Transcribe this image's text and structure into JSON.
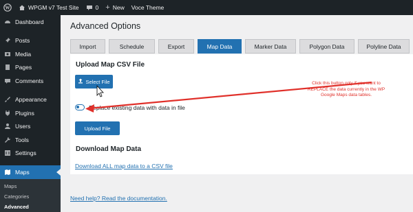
{
  "adminbar": {
    "site_name": "WPGM v7 Test Site",
    "comments_count": "0",
    "new_label": "New",
    "theme_label": "Voce Theme"
  },
  "sidebar": {
    "items": [
      {
        "label": "Dashboard",
        "icon": "dashboard-icon"
      },
      {
        "label": "Posts",
        "icon": "pin-icon"
      },
      {
        "label": "Media",
        "icon": "media-icon"
      },
      {
        "label": "Pages",
        "icon": "page-icon"
      },
      {
        "label": "Comments",
        "icon": "comment-icon"
      },
      {
        "label": "Appearance",
        "icon": "brush-icon"
      },
      {
        "label": "Plugins",
        "icon": "plug-icon"
      },
      {
        "label": "Users",
        "icon": "user-icon"
      },
      {
        "label": "Tools",
        "icon": "wrench-icon"
      },
      {
        "label": "Settings",
        "icon": "settings-icon"
      },
      {
        "label": "Maps",
        "icon": "map-icon"
      }
    ],
    "submenu": [
      "Maps",
      "Categories",
      "Advanced"
    ]
  },
  "main": {
    "title": "Advanced Options",
    "tabs": [
      "Import",
      "Schedule",
      "Export",
      "Map Data",
      "Marker Data",
      "Polygon Data",
      "Polyline Data"
    ],
    "active_tab": "Map Data",
    "upload_heading": "Upload Map CSV File",
    "select_file_label": "Select File",
    "replace_label": "Replace existing data with data in file",
    "replace_enabled": true,
    "upload_button_label": "Upload File",
    "download_heading": "Download Map Data",
    "download_link": "Download ALL map data to a CSV file",
    "help_link": "Need help? Read the documentation."
  },
  "annotation": {
    "lines": [
      "Click this button only if you want to",
      "REPLACE the data currently in the WP",
      "Google Maps data tables."
    ],
    "color": "#e0302a"
  },
  "colors": {
    "accent": "#2271b1",
    "adminbar": "#1d2327",
    "background": "#f0f0f1"
  }
}
